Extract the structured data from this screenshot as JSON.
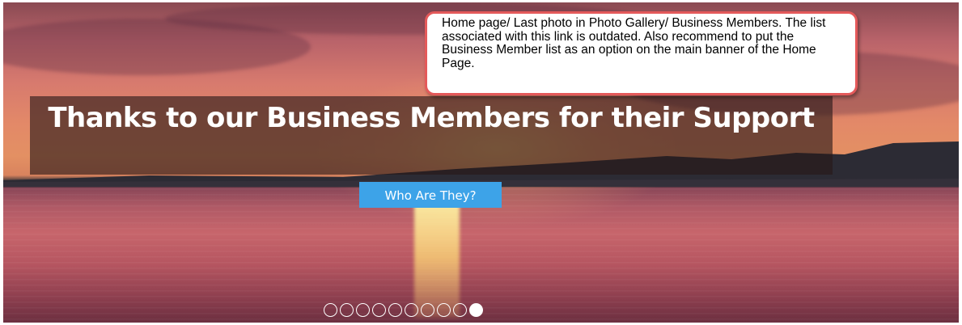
{
  "slide": {
    "title": "Thanks to our Business Members for their Support",
    "button_label": "Who Are They?"
  },
  "carousel": {
    "total_slides": 10,
    "active_index": 9
  },
  "annotation": {
    "text": "Home page/ Last photo in Photo Gallery/ Business Members.  The list associated with this link is outdated. Also recommend to put the Business Member list as an option on the main banner of the Home Page."
  },
  "colors": {
    "button": "#3da3e8",
    "callout_border": "#e4595a",
    "caption_overlay": "rgba(40,25,25,0.62)"
  }
}
